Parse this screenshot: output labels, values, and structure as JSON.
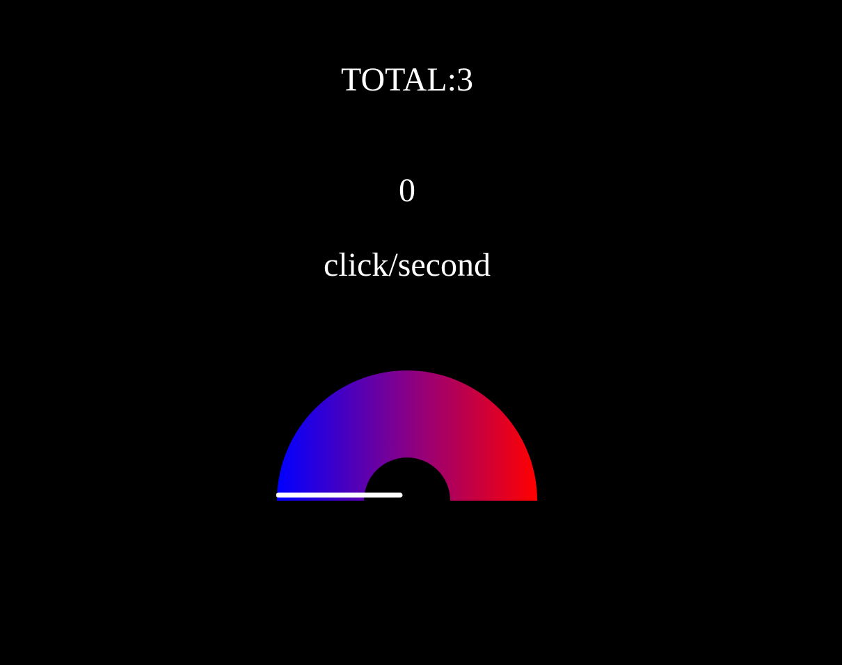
{
  "total": {
    "label": "TOTAL:",
    "value": "3"
  },
  "speed": {
    "value": "0",
    "unit": "click/second"
  },
  "gauge": {
    "level": 0,
    "colors": {
      "low": "#0000ff",
      "mid": "#880088",
      "high": "#ff0000",
      "hub": "#000000",
      "needle": "#ffffff"
    }
  }
}
